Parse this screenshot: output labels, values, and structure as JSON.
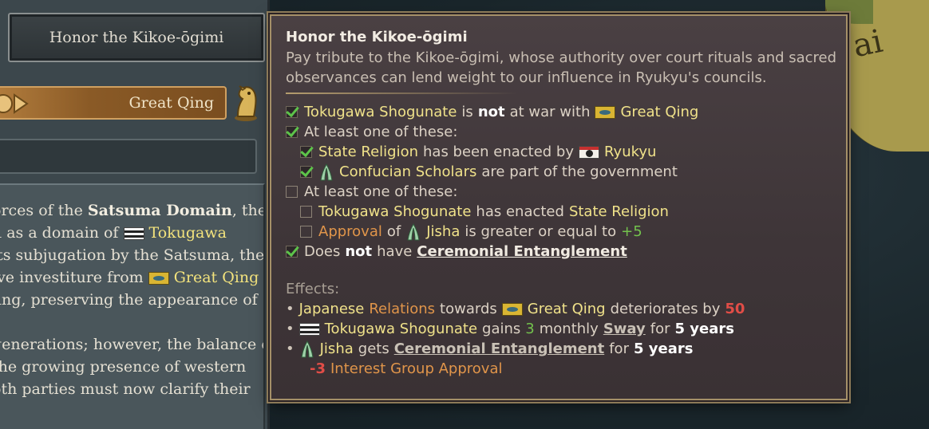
{
  "map": {
    "label": "ai"
  },
  "left_panel": {
    "option_label": "Honor the Kikoe-ōgimi",
    "target_label": "Great Qing",
    "description": {
      "lines": [
        [
          "orces of the ",
          "Satsuma Domain",
          ", the"
        ],
        [
          "d as a domain of ",
          "Tokugawa"
        ],
        [
          "its subjugation by the Satsuma, the"
        ],
        [
          "ive investiture from ",
          "Great Qing"
        ],
        [
          "jing, preserving the appearance of"
        ],
        [
          "generations; however, the balance of"
        ],
        [
          " the growing presence of western"
        ],
        [
          "oth parties must now clarify their"
        ]
      ]
    }
  },
  "tooltip": {
    "title": "Honor the Kikoe-ōgimi",
    "desc_line1": "Pay tribute to the Kikoe-ōgimi, whose authority over court rituals and sacred",
    "desc_line2": "observances can lend weight to our influence in Ryukyu's councils.",
    "conditions": {
      "c1": {
        "subject": "Tokugawa Shogunate",
        "is": "is",
        "not": "not",
        "rest": "at war with",
        "target": "Great Qing",
        "met": true
      },
      "c2": {
        "text": "At least one of these:",
        "met": true
      },
      "c2a": {
        "subject": "State Religion",
        "rest": "has been enacted by",
        "target": "Ryukyu",
        "met": true
      },
      "c2b": {
        "subject": "Confucian Scholars",
        "rest": "are part of the government",
        "met": true
      },
      "c3": {
        "text": "At least one of these:",
        "met": false
      },
      "c3a": {
        "subject": "Tokugawa Shogunate",
        "rest": "has enacted",
        "target": "State Religion",
        "met": false
      },
      "c3b": {
        "approval": "Approval",
        "of": "of",
        "group": "Jisha",
        "rest": "is greater or equal to",
        "value": "+5",
        "met": false
      },
      "c4": {
        "pre": "Does",
        "not": "not",
        "have": "have",
        "modifier": "Ceremonial Entanglement",
        "met": true
      }
    },
    "effects_label": "Effects:",
    "effects": {
      "e1": {
        "a": "Japanese",
        "b": "Relations",
        "c": "towards",
        "target": "Great Qing",
        "d": "deteriorates by",
        "value": "50"
      },
      "e2": {
        "subject": "Tokugawa Shogunate",
        "a": "gains",
        "value": "3",
        "b": "monthly",
        "link": "Sway",
        "c": "for",
        "dur": "5 years"
      },
      "e3": {
        "subject": "Jisha",
        "a": "gets",
        "link": "Ceremonial Entanglement",
        "c": "for",
        "dur": "5 years"
      },
      "e3b": {
        "value": "-3",
        "text": "Interest Group Approval"
      }
    }
  },
  "icons": [
    "arrow-icon",
    "knight-icon",
    "checkbox-icon",
    "flag-icon",
    "interest-group-icon"
  ],
  "colors": {
    "highlight_yellow": "#f0e28a",
    "approval_orange": "#e0954a",
    "positive_green": "#73c24d",
    "negative_red": "#e14d47",
    "tooltip_border": "#a59068"
  }
}
